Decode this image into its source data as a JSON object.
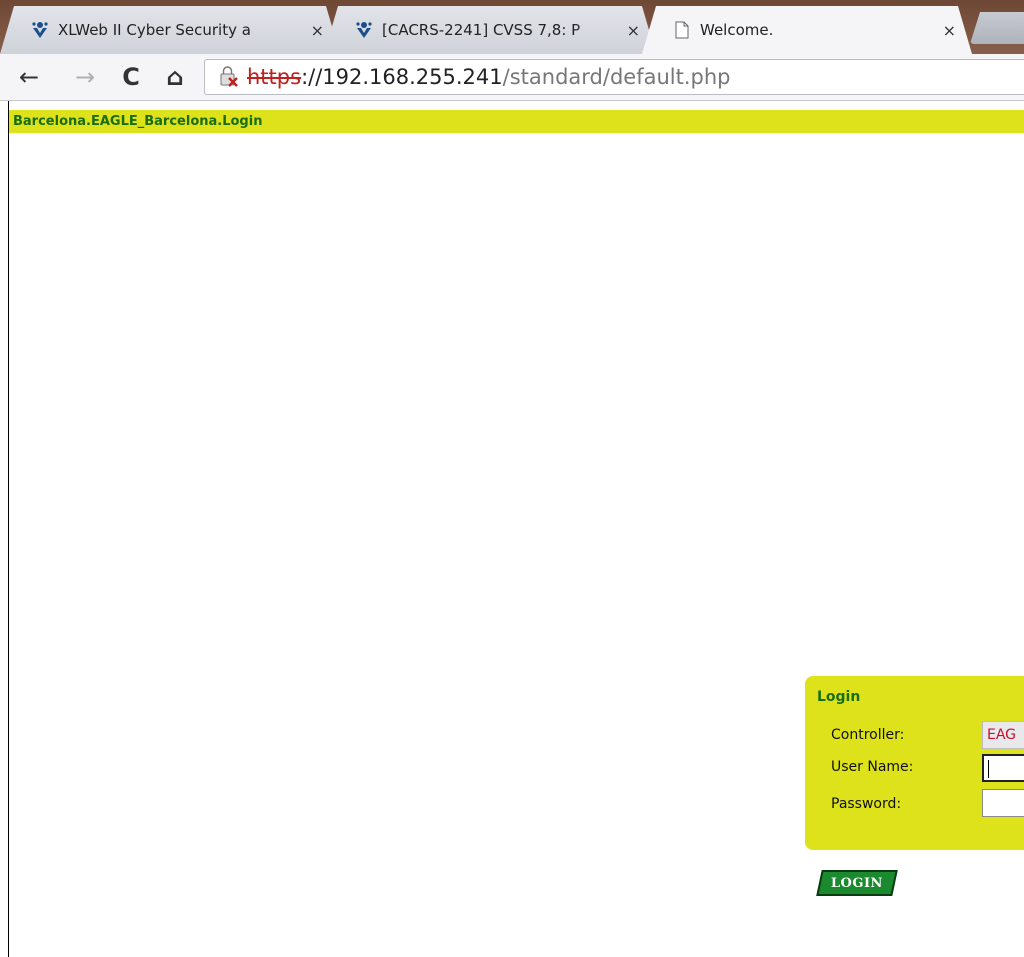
{
  "tabs": [
    {
      "title": "XLWeb II Cyber Security a",
      "icon": "jira-icon",
      "close": "×"
    },
    {
      "title": "[CACRS-2241] CVSS 7,8: P",
      "icon": "jira-icon",
      "close": "×"
    },
    {
      "title": "Welcome.",
      "icon": "page-icon",
      "close": "×"
    }
  ],
  "toolbar": {
    "back": "←",
    "forward": "→",
    "reload": "C",
    "home": "⌂"
  },
  "address": {
    "scheme": "https",
    "host": "://192.168.255.241",
    "path": "/standard/default.php"
  },
  "page": {
    "title": "Barcelona.EAGLE_Barcelona.Login"
  },
  "login": {
    "heading": "Login",
    "controller_label": "Controller:",
    "controller_value": "EAG",
    "username_label": "User Name:",
    "password_label": "Password:",
    "button_label": "LOGIN"
  },
  "colors": {
    "accent": "#dde21a",
    "text_green": "#1a6d14",
    "button_green": "#1b8a2e",
    "error_red": "#c0201e"
  }
}
